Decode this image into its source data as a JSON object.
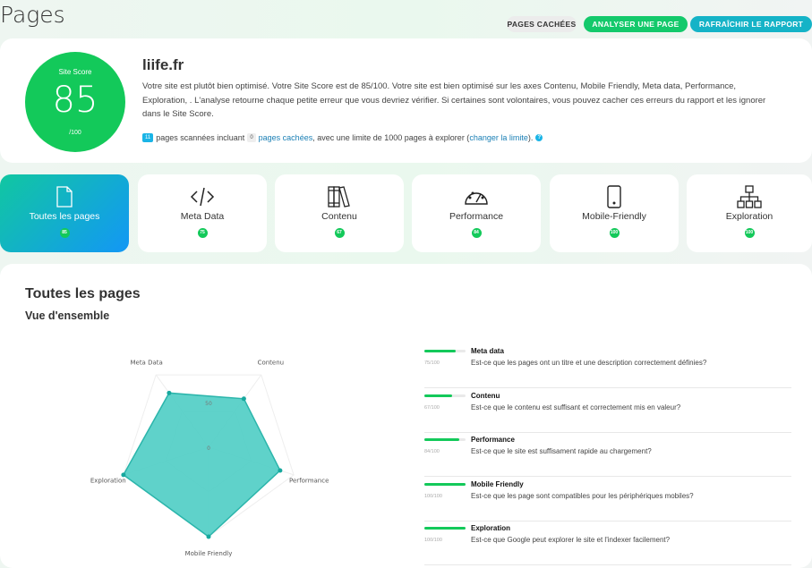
{
  "header": {
    "title": "Pages",
    "buttons": {
      "hidden": "PAGES CACHÉES",
      "analyze": "ANALYSER UNE PAGE",
      "refresh": "RAFRAÎCHIR LE RAPPORT"
    }
  },
  "summary": {
    "score_label": "Site Score",
    "score": "85",
    "score_max": "/100",
    "site": "liife.fr",
    "description": "Votre site est plutôt bien optimisé. Votre Site Score est de 85/100. Votre site est bien optimisé sur les axes Contenu, Mobile Friendly, Meta data, Performance, Exploration, . L'analyse retourne chaque petite erreur que vous devriez vérifier. Si certaines sont volontaires, vous pouvez cacher ces erreurs du rapport et les ignorer dans le Site Score.",
    "pages_count": "11",
    "text1": "pages scannées incluant",
    "hidden_count": "0",
    "hidden_link": "pages cachées",
    "text2": ", avec une limite de 1000 pages à explorer (",
    "limit_link": "changer la limite",
    "text3": ")."
  },
  "categories": [
    {
      "label": "Toutes les pages",
      "score": "85",
      "icon": "file-icon"
    },
    {
      "label": "Meta Data",
      "score": "75",
      "icon": "code-icon"
    },
    {
      "label": "Contenu",
      "score": "67",
      "icon": "books-icon"
    },
    {
      "label": "Performance",
      "score": "84",
      "icon": "gauge-icon"
    },
    {
      "label": "Mobile-Friendly",
      "score": "100",
      "icon": "mobile-icon"
    },
    {
      "label": "Exploration",
      "score": "100",
      "icon": "sitemap-icon"
    }
  ],
  "overview": {
    "title": "Toutes les pages",
    "subtitle": "Vue d'ensemble",
    "rows": [
      {
        "title": "Meta data",
        "value": 75,
        "label": "75/100",
        "desc": "Est-ce que les pages ont un titre et une description correctement définies?"
      },
      {
        "title": "Contenu",
        "value": 67,
        "label": "67/100",
        "desc": "Est-ce que le contenu est suffisant et correctement mis en valeur?"
      },
      {
        "title": "Performance",
        "value": 84,
        "label": "84/100",
        "desc": "Est-ce que le site est suffisament rapide au chargement?"
      },
      {
        "title": "Mobile Friendly",
        "value": 100,
        "label": "100/100",
        "desc": "Est-ce que les page sont compatibles pour les périphériques mobiles?"
      },
      {
        "title": "Exploration",
        "value": 100,
        "label": "100/100",
        "desc": "Est-ce que Google peut explorer le site et l'indexer facilement?"
      }
    ]
  },
  "chart_data": {
    "type": "radar",
    "categories": [
      "Mobile Friendly",
      "Performance",
      "Contenu",
      "Meta Data",
      "Exploration"
    ],
    "values": [
      100,
      84,
      67,
      75,
      100
    ],
    "ticks": [
      "0",
      "50"
    ],
    "range": [
      0,
      100
    ],
    "color": "#4ecdc4"
  },
  "colors": {
    "green": "#13c95a",
    "teal": "#15b3c7"
  }
}
